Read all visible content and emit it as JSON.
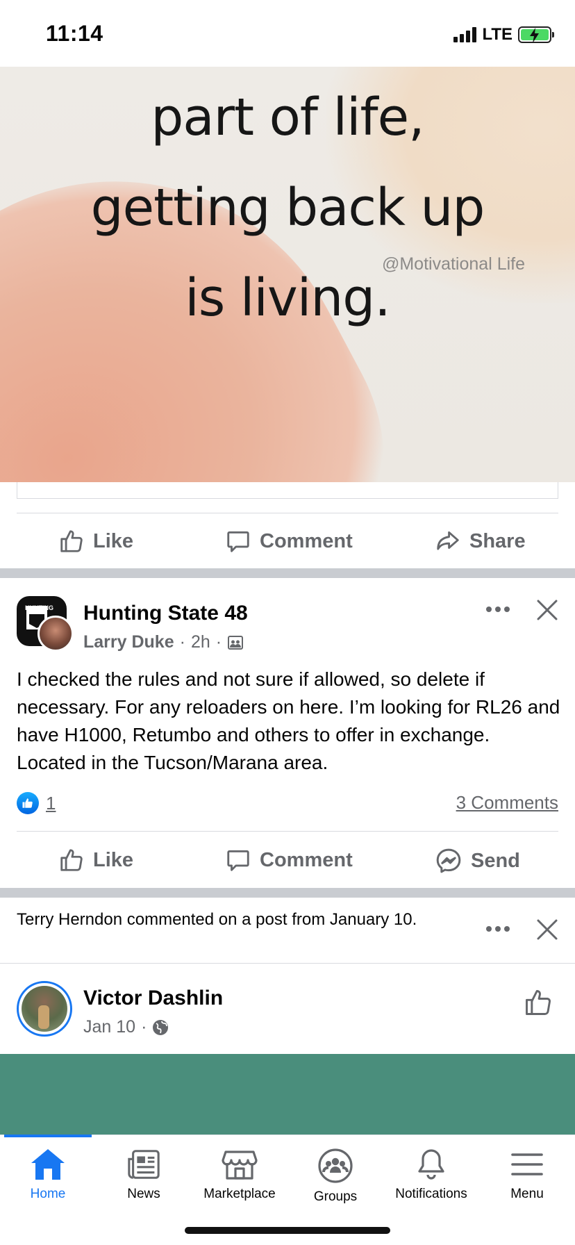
{
  "status_bar": {
    "time": "11:14",
    "network": "LTE"
  },
  "quote_post": {
    "image_lines": [
      "part of life,",
      "getting back up",
      "is living."
    ],
    "watermark": "@Motivational Life",
    "actions": {
      "like": "Like",
      "comment": "Comment",
      "share": "Share"
    }
  },
  "group_post": {
    "group_name": "Hunting State 48",
    "author": "Larry Duke",
    "time_ago": "2h",
    "separator": "·",
    "avatar_badge": "HUNTING",
    "body": "I checked the rules and not sure if allowed, so delete if necessary. For any reloaders on here. I’m looking for RL26 and have H1000, Retumbo and others to offer in exchange. Located in the Tucson/Marana area.",
    "reaction_count": "1",
    "comments_label": "3 Comments",
    "actions": {
      "like": "Like",
      "comment": "Comment",
      "send": "Send"
    }
  },
  "notice": {
    "text": "Terry Herndon commented on a post from January 10."
  },
  "victor_post": {
    "author": "Victor Dashlin",
    "date": "Jan 10",
    "separator": "·"
  },
  "tabbar": {
    "items": [
      {
        "label": "Home",
        "icon": "home-icon",
        "active": true
      },
      {
        "label": "News",
        "icon": "news-icon"
      },
      {
        "label": "Marketplace",
        "icon": "marketplace-icon"
      },
      {
        "label": "Groups",
        "icon": "groups-icon"
      },
      {
        "label": "Notifications",
        "icon": "bell-icon"
      },
      {
        "label": "Menu",
        "icon": "menu-icon"
      }
    ]
  },
  "colors": {
    "brand_blue": "#1877f2",
    "secondary_text": "#65676b",
    "separator": "#c9ccd1",
    "green_block": "#4a8e7c"
  }
}
